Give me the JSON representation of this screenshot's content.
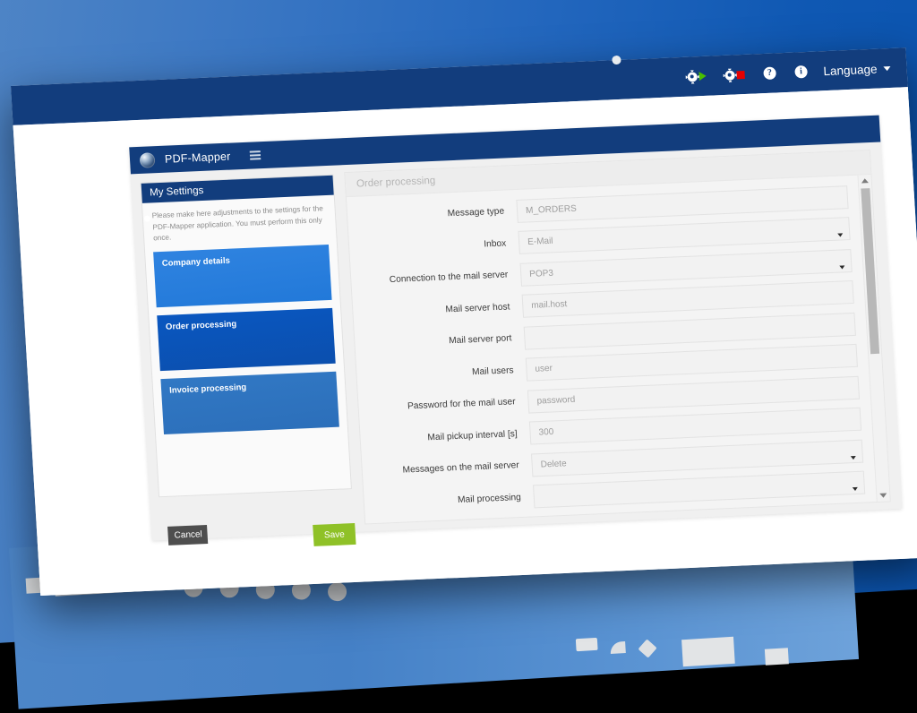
{
  "topnav": {
    "icons": [
      {
        "name": "start-service-icon",
        "glyph": "gear-play"
      },
      {
        "name": "stop-service-icon",
        "glyph": "gear-stop"
      },
      {
        "name": "help-icon",
        "glyph": "?"
      },
      {
        "name": "info-icon",
        "glyph": "i"
      }
    ],
    "language_label": "Language",
    "bg_color": "#123d7d"
  },
  "app": {
    "logo_name": "pdf-mapper-logo",
    "title": "PDF-Mapper",
    "menu_icon": "hamburger-menu-icon"
  },
  "sidebar": {
    "header": "My Settings",
    "description": "Please make here adjustments to the settings for the PDF-Mapper application. You must perform this only once.",
    "cards": [
      {
        "label": "Company details",
        "color": "#2f83e0",
        "selected": false
      },
      {
        "label": "Order processing",
        "color": "#0a57c0",
        "selected": true
      },
      {
        "label": "Invoice processing",
        "color": "#3178c4",
        "selected": false
      }
    ],
    "cancel_label": "Cancel",
    "save_label": "Save",
    "cancel_color": "#4e4e4e",
    "save_color": "#8fc127"
  },
  "form": {
    "title": "Order processing",
    "fields": [
      {
        "label": "Message type",
        "value": "M_ORDERS",
        "type": "text"
      },
      {
        "label": "Inbox",
        "value": "E-Mail",
        "type": "select"
      },
      {
        "label": "Connection to the mail server",
        "value": "POP3",
        "type": "select"
      },
      {
        "label": "Mail server host",
        "value": "mail.host",
        "type": "text"
      },
      {
        "label": "Mail server port",
        "value": "",
        "type": "text"
      },
      {
        "label": "Mail users",
        "value": "user",
        "type": "text"
      },
      {
        "label": "Password for the mail user",
        "value": "password",
        "type": "password"
      },
      {
        "label": "Mail pickup interval [s]",
        "value": "300",
        "type": "text"
      },
      {
        "label": "Messages on the mail server",
        "value": "Delete",
        "type": "select"
      },
      {
        "label": "Mail processing",
        "value": "",
        "type": "select"
      }
    ]
  },
  "scrollbar": {
    "up_icon": "scroll-up-arrow-icon",
    "down_icon": "scroll-down-arrow-icon",
    "thumb_name": "scrollbar-thumb"
  },
  "decor": {
    "bar_circles": 5,
    "shapes": [
      "rect",
      "quarter-circle",
      "diamond",
      "rect-large",
      "rect-small"
    ]
  }
}
